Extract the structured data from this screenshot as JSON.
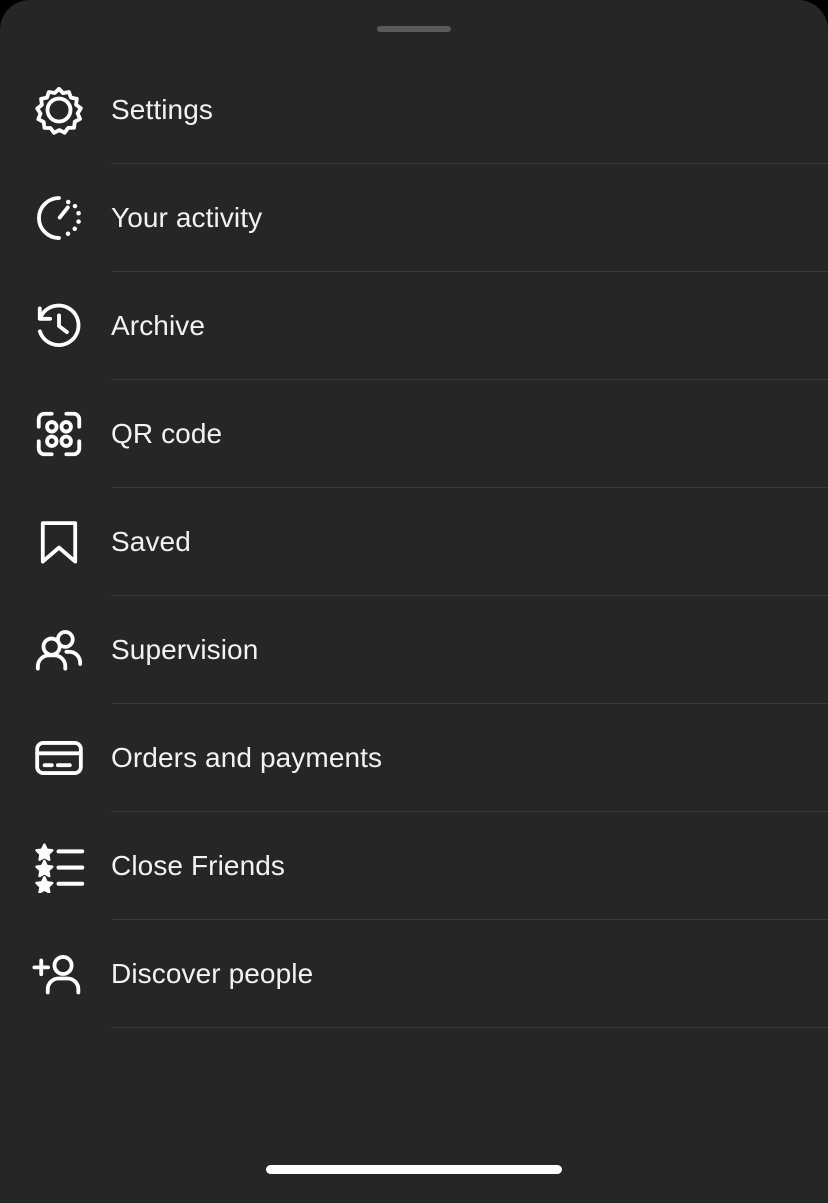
{
  "sheet": {
    "background_color": "#262626",
    "outer_background_color": "#000000",
    "drag_handle_color": "#5a5a5a",
    "divider_color": "#393939",
    "text_color": "#f2f2f2",
    "home_indicator_color": "#ffffff"
  },
  "menu": {
    "items": [
      {
        "label": "Settings",
        "icon": "gear-icon"
      },
      {
        "label": "Your activity",
        "icon": "activity-timer-icon"
      },
      {
        "label": "Archive",
        "icon": "archive-history-clock-icon"
      },
      {
        "label": "QR code",
        "icon": "qr-code-icon"
      },
      {
        "label": "Saved",
        "icon": "bookmark-icon"
      },
      {
        "label": "Supervision",
        "icon": "two-people-icon"
      },
      {
        "label": "Orders and payments",
        "icon": "credit-card-icon"
      },
      {
        "label": "Close Friends",
        "icon": "star-list-icon"
      },
      {
        "label": "Discover people",
        "icon": "person-add-icon"
      }
    ]
  }
}
